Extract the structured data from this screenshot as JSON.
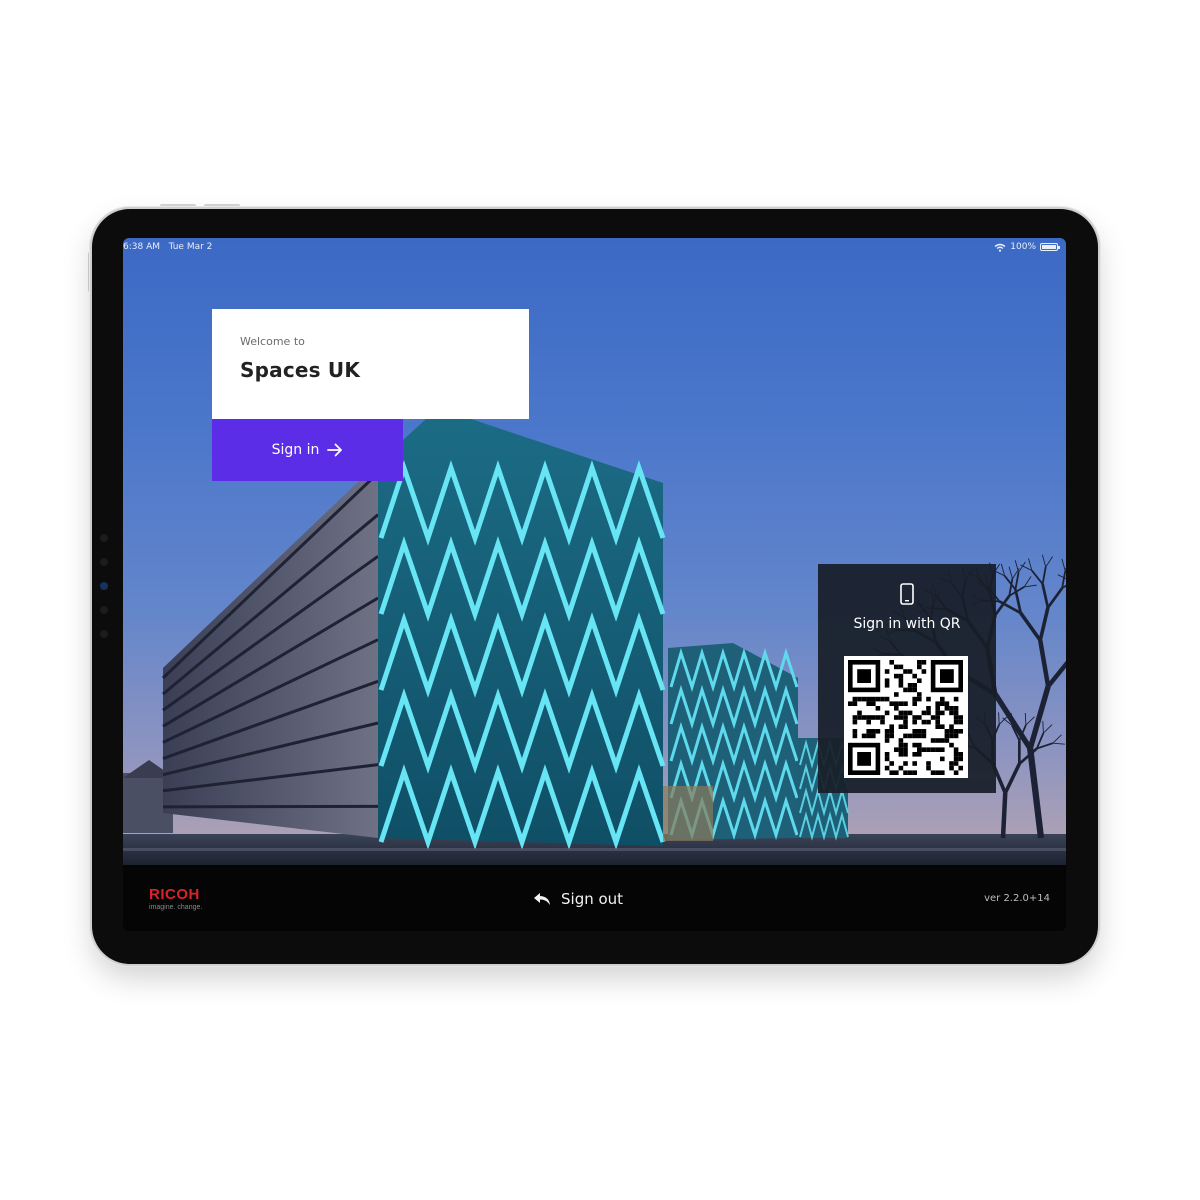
{
  "status_bar": {
    "time": "6:38 AM",
    "date": "Tue Mar 2",
    "battery": "100%",
    "icons": [
      "wifi-icon",
      "battery-icon"
    ]
  },
  "welcome_card": {
    "label": "Welcome to",
    "title": "Spaces UK"
  },
  "sign_in_button": {
    "label": "Sign in",
    "icon": "arrow-right-icon"
  },
  "qr_panel": {
    "icon": "phone-icon",
    "title": "Sign in with QR"
  },
  "bottom_bar": {
    "logo_name": "RICOH",
    "logo_tagline": "imagine. change.",
    "sign_out_label": "Sign out",
    "sign_out_icon": "reply-arrow-icon",
    "version": "ver 2.2.0+14"
  },
  "colors": {
    "accent": "#5b2de6",
    "brand_red": "#d9222a",
    "bar_background": "#050505",
    "qr_panel_background": "#181e28"
  }
}
